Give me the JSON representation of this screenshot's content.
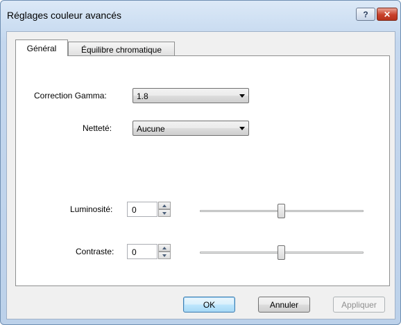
{
  "window": {
    "title": "Réglages couleur avancés",
    "help_label": "?",
    "close_label": "✕"
  },
  "tabs": [
    {
      "label": "Général",
      "active": true
    },
    {
      "label": "Équilibre chromatique",
      "active": false
    }
  ],
  "general": {
    "gamma": {
      "label": "Correction Gamma:",
      "value": "1.8"
    },
    "nettete": {
      "label": "Netteté:",
      "value": "Aucune"
    },
    "luminosite": {
      "label": "Luminosité:",
      "value": "0"
    },
    "contraste": {
      "label": "Contraste:",
      "value": "0"
    }
  },
  "buttons": {
    "ok": "OK",
    "cancel": "Annuler",
    "apply": "Appliquer"
  },
  "colors": {
    "accent": "#3c7fb1",
    "close": "#c8402a",
    "frame": "#cfe0f3"
  }
}
